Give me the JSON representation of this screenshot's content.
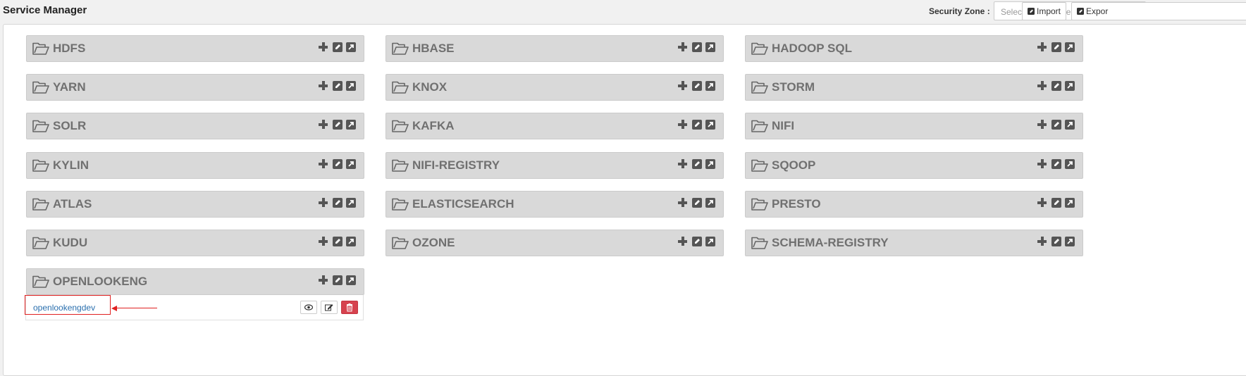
{
  "header": {
    "title": "Service Manager",
    "zone_label": "Security Zone :",
    "zone_placeholder": "Select Zone Name",
    "import_label": "Import",
    "export_label": "Expor"
  },
  "services": [
    {
      "name": "HDFS"
    },
    {
      "name": "HBASE"
    },
    {
      "name": "HADOOP SQL"
    },
    {
      "name": "YARN"
    },
    {
      "name": "KNOX"
    },
    {
      "name": "STORM"
    },
    {
      "name": "SOLR"
    },
    {
      "name": "KAFKA"
    },
    {
      "name": "NIFI"
    },
    {
      "name": "KYLIN"
    },
    {
      "name": "NIFI-REGISTRY"
    },
    {
      "name": "SQOOP"
    },
    {
      "name": "ATLAS"
    },
    {
      "name": "ELASTICSEARCH"
    },
    {
      "name": "PRESTO"
    },
    {
      "name": "KUDU"
    },
    {
      "name": "OZONE"
    },
    {
      "name": "SCHEMA-REGISTRY"
    },
    {
      "name": "OPENLOOKENG"
    }
  ],
  "expanded": {
    "service": "OPENLOOKENG",
    "repo_name": "openlookengdev"
  },
  "colors": {
    "service_bar": "#d9d9d9",
    "service_text": "#707070",
    "link": "#2a6fae",
    "delete": "#d6424e",
    "annotation": "#e02020"
  },
  "icons": {
    "folder": "folder-open-icon",
    "add": "plus-icon",
    "edit": "edit-icon",
    "export": "external-link-icon",
    "view": "eye-icon",
    "delete": "trash-icon"
  }
}
